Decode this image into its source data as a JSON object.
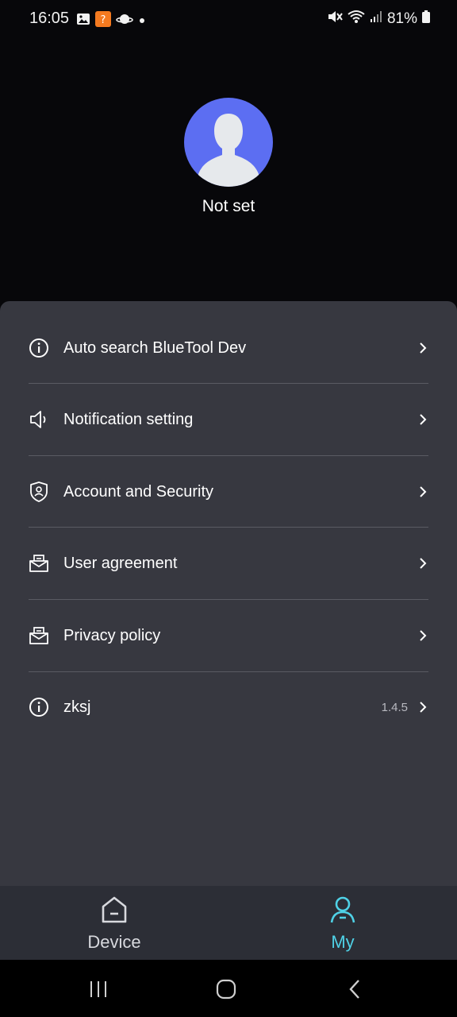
{
  "status_bar": {
    "time": "16:05",
    "battery_percent": "81%"
  },
  "profile": {
    "name": "Not set",
    "avatar_color": "#5c6ef2"
  },
  "menu": {
    "items": [
      {
        "label": "Auto search BlueTool Dev",
        "icon": "info-icon",
        "value": ""
      },
      {
        "label": "Notification setting",
        "icon": "speaker-icon",
        "value": ""
      },
      {
        "label": "Account and Security",
        "icon": "shield-user-icon",
        "value": ""
      },
      {
        "label": "User agreement",
        "icon": "mail-doc-icon",
        "value": ""
      },
      {
        "label": "Privacy policy",
        "icon": "mail-doc-icon",
        "value": ""
      },
      {
        "label": "zksj",
        "icon": "info-icon",
        "value": "1.4.5"
      }
    ]
  },
  "bottom_nav": {
    "tabs": [
      {
        "label": "Device",
        "icon": "home-icon",
        "active": false
      },
      {
        "label": "My",
        "icon": "user-icon",
        "active": true
      }
    ],
    "active_color": "#4fd1e6",
    "inactive_color": "#d8d9de"
  },
  "colors": {
    "background": "#07070a",
    "panel": "#373840",
    "nav_bar": "#2c2e36"
  }
}
